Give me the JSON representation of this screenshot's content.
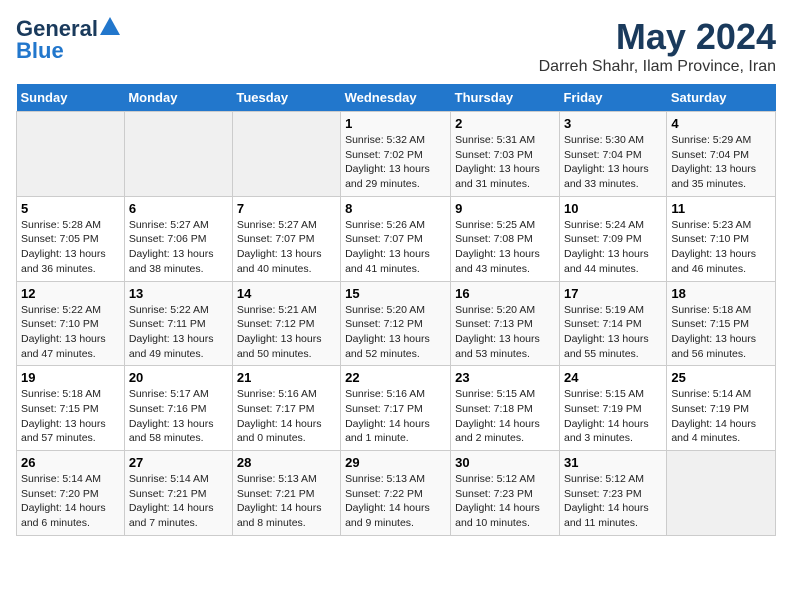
{
  "logo": {
    "line1": "General",
    "line2": "Blue"
  },
  "title": "May 2024",
  "location": "Darreh Shahr, Ilam Province, Iran",
  "days_of_week": [
    "Sunday",
    "Monday",
    "Tuesday",
    "Wednesday",
    "Thursday",
    "Friday",
    "Saturday"
  ],
  "weeks": [
    [
      {
        "day": "",
        "info": ""
      },
      {
        "day": "",
        "info": ""
      },
      {
        "day": "",
        "info": ""
      },
      {
        "day": "1",
        "info": "Sunrise: 5:32 AM\nSunset: 7:02 PM\nDaylight: 13 hours\nand 29 minutes."
      },
      {
        "day": "2",
        "info": "Sunrise: 5:31 AM\nSunset: 7:03 PM\nDaylight: 13 hours\nand 31 minutes."
      },
      {
        "day": "3",
        "info": "Sunrise: 5:30 AM\nSunset: 7:04 PM\nDaylight: 13 hours\nand 33 minutes."
      },
      {
        "day": "4",
        "info": "Sunrise: 5:29 AM\nSunset: 7:04 PM\nDaylight: 13 hours\nand 35 minutes."
      }
    ],
    [
      {
        "day": "5",
        "info": "Sunrise: 5:28 AM\nSunset: 7:05 PM\nDaylight: 13 hours\nand 36 minutes."
      },
      {
        "day": "6",
        "info": "Sunrise: 5:27 AM\nSunset: 7:06 PM\nDaylight: 13 hours\nand 38 minutes."
      },
      {
        "day": "7",
        "info": "Sunrise: 5:27 AM\nSunset: 7:07 PM\nDaylight: 13 hours\nand 40 minutes."
      },
      {
        "day": "8",
        "info": "Sunrise: 5:26 AM\nSunset: 7:07 PM\nDaylight: 13 hours\nand 41 minutes."
      },
      {
        "day": "9",
        "info": "Sunrise: 5:25 AM\nSunset: 7:08 PM\nDaylight: 13 hours\nand 43 minutes."
      },
      {
        "day": "10",
        "info": "Sunrise: 5:24 AM\nSunset: 7:09 PM\nDaylight: 13 hours\nand 44 minutes."
      },
      {
        "day": "11",
        "info": "Sunrise: 5:23 AM\nSunset: 7:10 PM\nDaylight: 13 hours\nand 46 minutes."
      }
    ],
    [
      {
        "day": "12",
        "info": "Sunrise: 5:22 AM\nSunset: 7:10 PM\nDaylight: 13 hours\nand 47 minutes."
      },
      {
        "day": "13",
        "info": "Sunrise: 5:22 AM\nSunset: 7:11 PM\nDaylight: 13 hours\nand 49 minutes."
      },
      {
        "day": "14",
        "info": "Sunrise: 5:21 AM\nSunset: 7:12 PM\nDaylight: 13 hours\nand 50 minutes."
      },
      {
        "day": "15",
        "info": "Sunrise: 5:20 AM\nSunset: 7:12 PM\nDaylight: 13 hours\nand 52 minutes."
      },
      {
        "day": "16",
        "info": "Sunrise: 5:20 AM\nSunset: 7:13 PM\nDaylight: 13 hours\nand 53 minutes."
      },
      {
        "day": "17",
        "info": "Sunrise: 5:19 AM\nSunset: 7:14 PM\nDaylight: 13 hours\nand 55 minutes."
      },
      {
        "day": "18",
        "info": "Sunrise: 5:18 AM\nSunset: 7:15 PM\nDaylight: 13 hours\nand 56 minutes."
      }
    ],
    [
      {
        "day": "19",
        "info": "Sunrise: 5:18 AM\nSunset: 7:15 PM\nDaylight: 13 hours\nand 57 minutes."
      },
      {
        "day": "20",
        "info": "Sunrise: 5:17 AM\nSunset: 7:16 PM\nDaylight: 13 hours\nand 58 minutes."
      },
      {
        "day": "21",
        "info": "Sunrise: 5:16 AM\nSunset: 7:17 PM\nDaylight: 14 hours\nand 0 minutes."
      },
      {
        "day": "22",
        "info": "Sunrise: 5:16 AM\nSunset: 7:17 PM\nDaylight: 14 hours\nand 1 minute."
      },
      {
        "day": "23",
        "info": "Sunrise: 5:15 AM\nSunset: 7:18 PM\nDaylight: 14 hours\nand 2 minutes."
      },
      {
        "day": "24",
        "info": "Sunrise: 5:15 AM\nSunset: 7:19 PM\nDaylight: 14 hours\nand 3 minutes."
      },
      {
        "day": "25",
        "info": "Sunrise: 5:14 AM\nSunset: 7:19 PM\nDaylight: 14 hours\nand 4 minutes."
      }
    ],
    [
      {
        "day": "26",
        "info": "Sunrise: 5:14 AM\nSunset: 7:20 PM\nDaylight: 14 hours\nand 6 minutes."
      },
      {
        "day": "27",
        "info": "Sunrise: 5:14 AM\nSunset: 7:21 PM\nDaylight: 14 hours\nand 7 minutes."
      },
      {
        "day": "28",
        "info": "Sunrise: 5:13 AM\nSunset: 7:21 PM\nDaylight: 14 hours\nand 8 minutes."
      },
      {
        "day": "29",
        "info": "Sunrise: 5:13 AM\nSunset: 7:22 PM\nDaylight: 14 hours\nand 9 minutes."
      },
      {
        "day": "30",
        "info": "Sunrise: 5:12 AM\nSunset: 7:23 PM\nDaylight: 14 hours\nand 10 minutes."
      },
      {
        "day": "31",
        "info": "Sunrise: 5:12 AM\nSunset: 7:23 PM\nDaylight: 14 hours\nand 11 minutes."
      },
      {
        "day": "",
        "info": ""
      }
    ]
  ]
}
